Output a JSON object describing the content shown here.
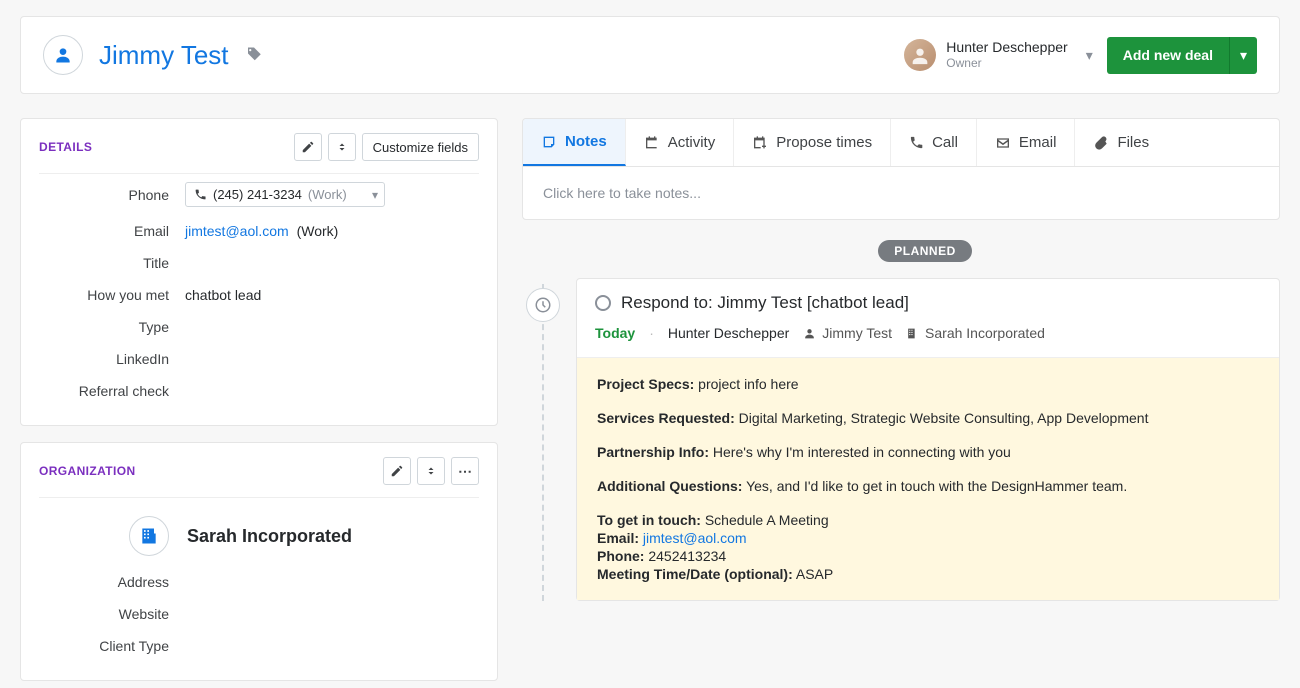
{
  "header": {
    "contact_name": "Jimmy Test",
    "owner_name": "Hunter Deschepper",
    "owner_role": "Owner",
    "add_deal_label": "Add new deal"
  },
  "details": {
    "title": "DETAILS",
    "customize_btn": "Customize fields",
    "fields": {
      "phone_label": "Phone",
      "phone_value": "(245) 241-3234",
      "phone_type": "(Work)",
      "email_label": "Email",
      "email_value": "jimtest@aol.com",
      "email_type": "(Work)",
      "title_label": "Title",
      "how_met_label": "How you met",
      "how_met_value": "chatbot lead",
      "type_label": "Type",
      "linkedin_label": "LinkedIn",
      "referral_label": "Referral check"
    }
  },
  "organization": {
    "title": "ORGANIZATION",
    "name": "Sarah Incorporated",
    "fields": {
      "address_label": "Address",
      "website_label": "Website",
      "client_type_label": "Client Type"
    }
  },
  "tabs": {
    "notes": "Notes",
    "activity": "Activity",
    "propose": "Propose times",
    "call": "Call",
    "email": "Email",
    "files": "Files"
  },
  "notes_placeholder": "Click here to take notes...",
  "planned_label": "PLANNED",
  "activity": {
    "title": "Respond to: Jimmy Test [chatbot lead]",
    "today": "Today",
    "owner": "Hunter Deschepper",
    "person": "Jimmy Test",
    "org": "Sarah Incorporated",
    "body": {
      "project_specs_label": "Project Specs:",
      "project_specs_value": " project info here",
      "services_label": "Services Requested:",
      "services_value": " Digital Marketing, Strategic Website Consulting, App Development",
      "partnership_label": "Partnership Info:",
      "partnership_value": " Here's why I'm interested in connecting with you",
      "questions_label": "Additional Questions:",
      "questions_value": " Yes, and I'd like to get in touch with the DesignHammer team.",
      "touch_label": "To get in touch:",
      "touch_value": " Schedule A Meeting",
      "email_label": "Email:",
      "email_value": "jimtest@aol.com",
      "phone_label": "Phone:",
      "phone_value": " 2452413234",
      "meeting_label": "Meeting Time/Date (optional):",
      "meeting_value": " ASAP"
    }
  }
}
